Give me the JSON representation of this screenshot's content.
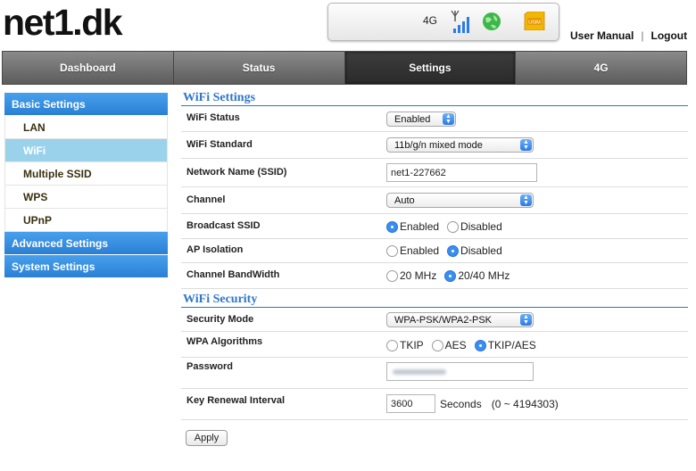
{
  "brand": {
    "logo": "net1.dk"
  },
  "status_bar": {
    "network_type": "4G",
    "icons": [
      "signal-bars-icon",
      "globe-icon",
      "usim-card-icon"
    ],
    "usim_label": "USIM"
  },
  "top_links": {
    "manual": "User Manual",
    "separator": "|",
    "logout": "Logout"
  },
  "nav": {
    "tabs": [
      {
        "label": "Dashboard"
      },
      {
        "label": "Status"
      },
      {
        "label": "Settings",
        "active": true
      },
      {
        "label": "4G"
      }
    ]
  },
  "sidebar": {
    "basic": "Basic Settings",
    "items": [
      {
        "label": "LAN"
      },
      {
        "label": "WiFi",
        "active": true
      },
      {
        "label": "Multiple SSID"
      },
      {
        "label": "WPS"
      },
      {
        "label": "UPnP"
      }
    ],
    "advanced": "Advanced Settings",
    "system": "System Settings"
  },
  "wifi_settings": {
    "title": "WiFi Settings",
    "status_label": "WiFi Status",
    "status_value": "Enabled",
    "standard_label": "WiFi Standard",
    "standard_value": "11b/g/n mixed mode",
    "ssid_label": "Network Name (SSID)",
    "ssid_value": "net1-227662",
    "channel_label": "Channel",
    "channel_value": "Auto",
    "broadcast_label": "Broadcast SSID",
    "broadcast_options": [
      "Enabled",
      "Disabled"
    ],
    "broadcast_selected": "Enabled",
    "isolation_label": "AP Isolation",
    "isolation_options": [
      "Enabled",
      "Disabled"
    ],
    "isolation_selected": "Disabled",
    "bandwidth_label": "Channel BandWidth",
    "bandwidth_options": [
      "20 MHz",
      "20/40 MHz"
    ],
    "bandwidth_selected": "20/40 MHz"
  },
  "wifi_security": {
    "title": "WiFi Security",
    "mode_label": "Security Mode",
    "mode_value": "WPA-PSK/WPA2-PSK",
    "algo_label": "WPA Algorithms",
    "algo_options": [
      "TKIP",
      "AES",
      "TKIP/AES"
    ],
    "algo_selected": "TKIP/AES",
    "password_label": "Password",
    "renewal_label": "Key Renewal Interval",
    "renewal_value": "3600",
    "renewal_unit": "Seconds",
    "renewal_range": "(0 ~ 4194303)"
  },
  "apply_label": "Apply",
  "colors": {
    "accent_blue": "#2f76c8",
    "sidebar_blue": "#2a7fd4",
    "sidebar_active": "#9ad2ec",
    "radio_on": "#3a8ef0"
  }
}
